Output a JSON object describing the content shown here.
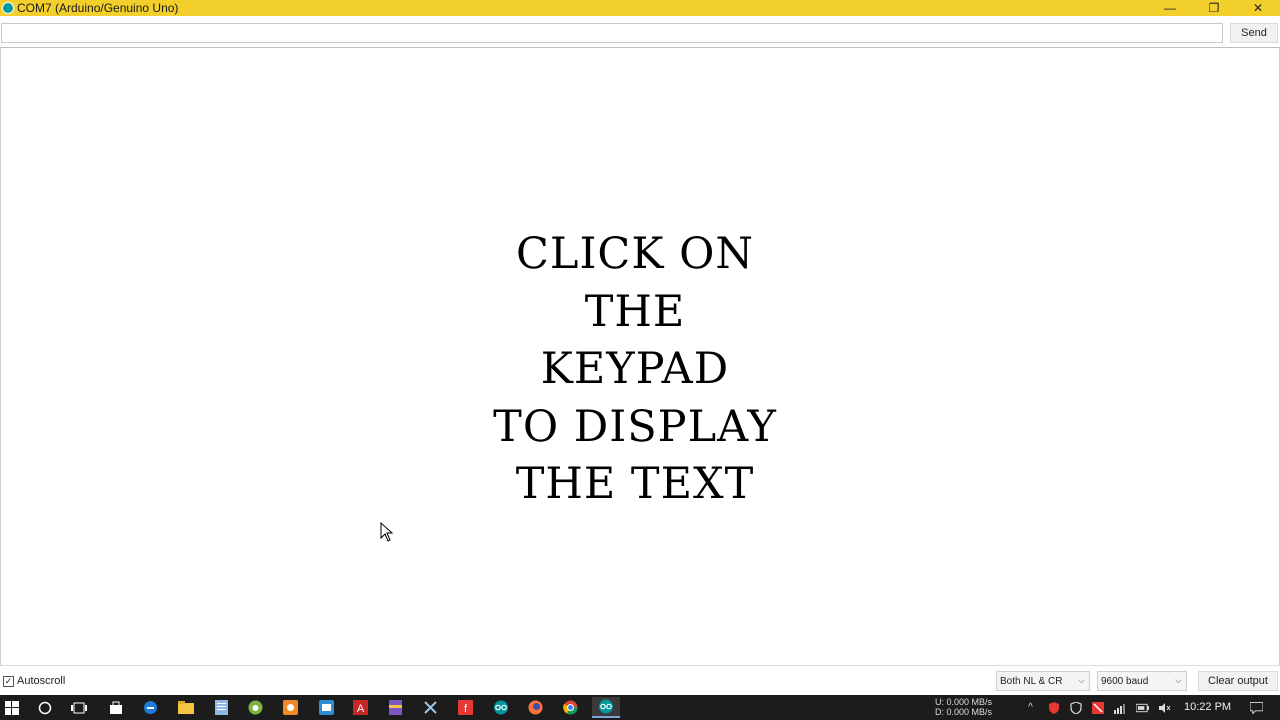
{
  "window": {
    "title": "COM7 (Arduino/Genuino Uno)",
    "minimize_glyph": "—",
    "restore_glyph": "❐",
    "close_glyph": "✕",
    "accent_color": "#f2cf2a"
  },
  "send_bar": {
    "input_value": "",
    "send_label": "Send"
  },
  "output": {
    "lines": [
      "CLICK ON",
      "THE",
      "KEYPAD",
      "TO DISPLAY",
      "THE TEXT"
    ]
  },
  "bottom_bar": {
    "autoscroll_label": "Autoscroll",
    "autoscroll_checked": true,
    "line_ending": "Both NL & CR",
    "baud_rate": "9600 baud",
    "clear_label": "Clear output"
  },
  "taskbar": {
    "icons": [
      "windows-start-icon",
      "cortana-icon",
      "task-view-icon",
      "store-icon",
      "edge-icon",
      "file-explorer-icon",
      "notepad-icon",
      "android-icon",
      "app-icon-orange",
      "app-icon-blue",
      "acrobat-icon",
      "winrar-icon",
      "snipping-icon",
      "foxit-icon",
      "arduino-icon",
      "firefox-icon",
      "chrome-icon",
      "arduino-active-icon"
    ],
    "net_upload": "U:   0.000 MB/s",
    "net_download": "D:   0.000 MB/s",
    "clock": "10:22 PM"
  }
}
